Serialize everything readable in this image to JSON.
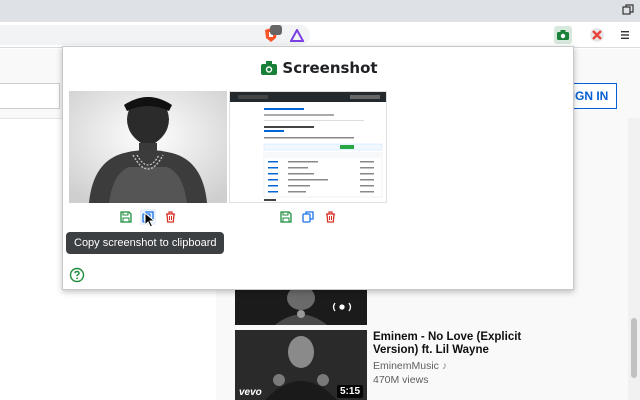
{
  "page": {
    "sign_in_label": "SIGN IN"
  },
  "extensions": [
    {
      "name": "brave-shield",
      "badge": ""
    },
    {
      "name": "brave-rewards"
    },
    {
      "name": "screenshot-extension"
    },
    {
      "name": "other-extension"
    }
  ],
  "popup": {
    "title": "Screenshot",
    "tooltip": "Copy screenshot to clipboard",
    "screenshots": [
      {
        "actions": [
          "save-icon",
          "copy-icon",
          "delete-icon"
        ]
      },
      {
        "actions": [
          "save-icon",
          "copy-icon",
          "delete-icon"
        ]
      }
    ]
  },
  "videos": [
    {
      "duration": ""
    },
    {
      "title": "Eminem - No Love (Explicit Version) ft. Lil Wayne",
      "channel": "EminemMusic",
      "views": "470M views",
      "duration": "5:15",
      "badge": "vevo"
    }
  ],
  "colors": {
    "save": "#1e8e3e",
    "copy": "#1a73e8",
    "delete": "#d93025",
    "accent": "#065fd4"
  }
}
